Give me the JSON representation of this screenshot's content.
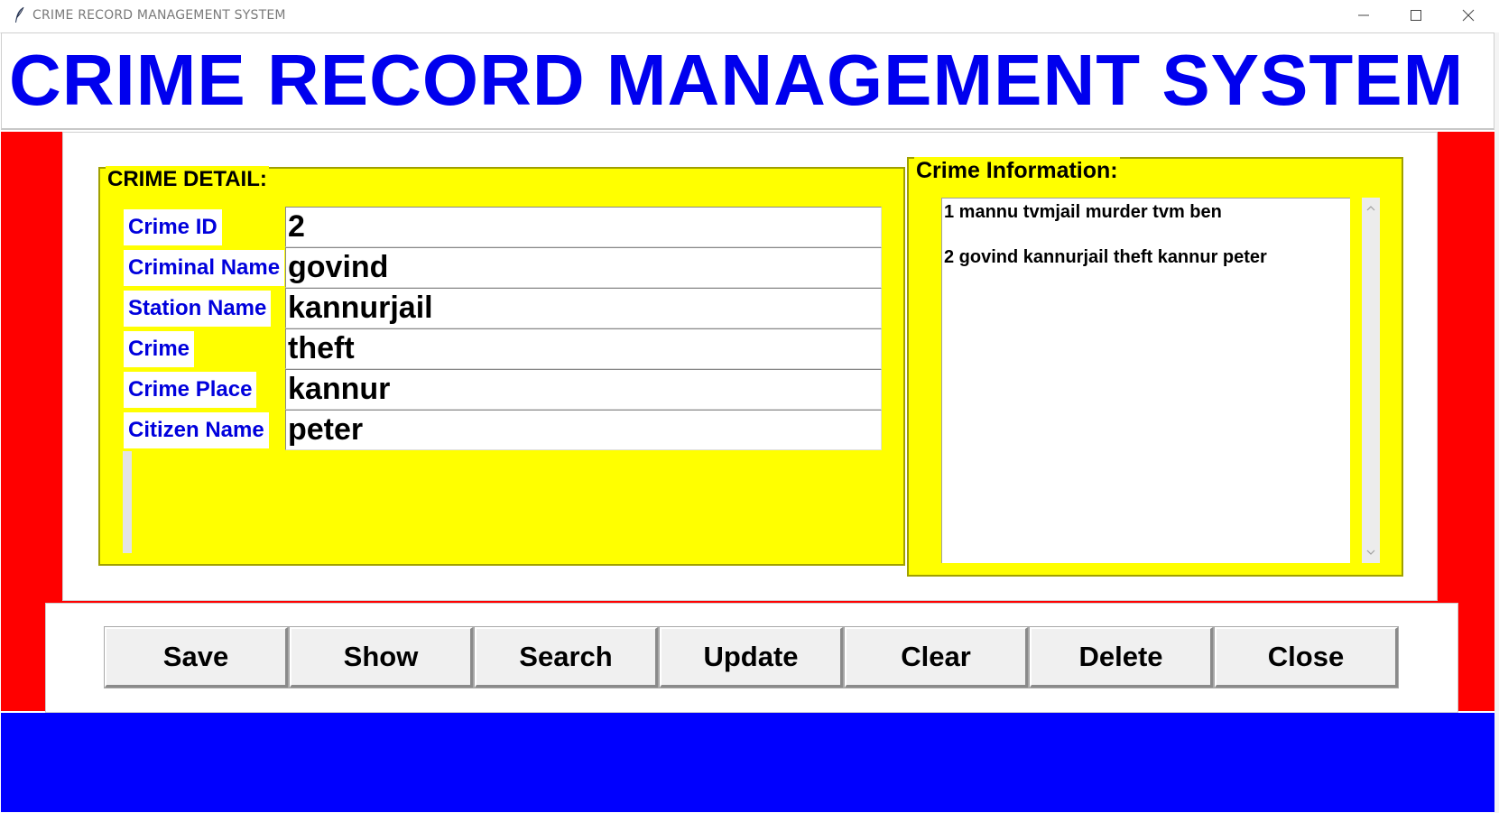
{
  "window": {
    "title": "CRIME RECORD MANAGEMENT SYSTEM",
    "icon": "feather-icon",
    "controls": [
      "minimize-icon",
      "maximize-icon",
      "close-icon"
    ]
  },
  "header": {
    "banner": "CRIME RECORD MANAGEMENT SYSTEM",
    "banner_color": "#0000ee"
  },
  "crime_detail": {
    "title": "CRIME DETAIL:",
    "fields": [
      {
        "label": "Crime ID",
        "value": "2"
      },
      {
        "label": "Criminal Name",
        "value": "govind"
      },
      {
        "label": "Station Name",
        "value": "kannurjail"
      },
      {
        "label": "Crime",
        "value": "theft"
      },
      {
        "label": "Crime Place",
        "value": "kannur"
      },
      {
        "label": "Citizen Name",
        "value": "peter"
      }
    ]
  },
  "crime_information": {
    "title": "Crime Information:",
    "records": [
      "1 mannu tvmjail murder tvm ben",
      "2 govind kannurjail theft kannur peter"
    ]
  },
  "buttons": {
    "save": "Save",
    "show": "Show",
    "search": "Search",
    "update": "Update",
    "clear": "Clear",
    "delete": "Delete",
    "close": "Close"
  },
  "colors": {
    "body_background": "#ff0000",
    "frame_background": "#ffff00",
    "label_text": "#0000dd",
    "footer": "#0000ff"
  }
}
